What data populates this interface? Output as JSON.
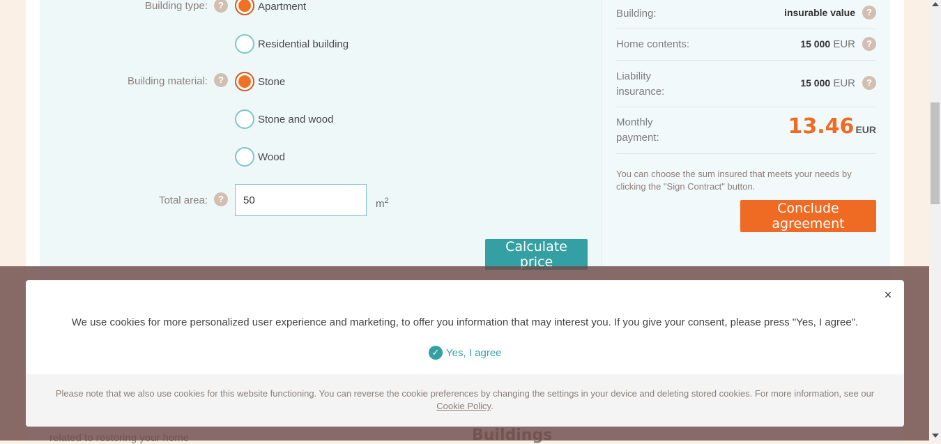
{
  "form": {
    "building_type": {
      "label": "Building type:",
      "options": [
        {
          "label": "Apartment",
          "selected": true
        },
        {
          "label": "Residential building",
          "selected": false
        }
      ]
    },
    "building_material": {
      "label": "Building material:",
      "options": [
        {
          "label": "Stone",
          "selected": true
        },
        {
          "label": "Stone and wood",
          "selected": false
        },
        {
          "label": "Wood",
          "selected": false
        }
      ]
    },
    "total_area": {
      "label": "Total area:",
      "value": "50",
      "unit": "m",
      "unit_sup": "2"
    },
    "help_glyph": "?",
    "calculate_label": "Calculate price"
  },
  "summary": {
    "building": {
      "label": "Building:",
      "value": "insurable value"
    },
    "home_contents": {
      "label": "Home contents:",
      "amount": "15 000",
      "currency": "EUR"
    },
    "liability": {
      "label": "Liability insurance:",
      "amount": "15 000",
      "currency": "EUR"
    },
    "monthly": {
      "label": "Monthly payment:",
      "amount": "13.46",
      "currency": "EUR"
    },
    "note": "You can choose the sum insured that meets your needs by clicking the \"Sign Contract\" button.",
    "conclude_label": "Conclude agreement"
  },
  "background": {
    "text_left": "related to restoring your home",
    "text_right": "Buildings"
  },
  "cookie": {
    "close_glyph": "×",
    "message": "We use cookies for more personalized user experience and marketing, to offer you information that may interest you. If you give your consent, please press \"Yes, I agree\".",
    "agree_label": "Yes, I agree",
    "check_glyph": "✓",
    "footer_text": "Please note that we also use cookies for this website functioning. You can reverse the cookie preferences by changing the settings in your device and deleting stored cookies. For more information, see our",
    "policy_link": "Cookie Policy",
    "footer_end": "."
  },
  "colors": {
    "accent_orange": "#ef6a22",
    "accent_teal": "#34a0a4",
    "overlay": "#6c4a48"
  }
}
